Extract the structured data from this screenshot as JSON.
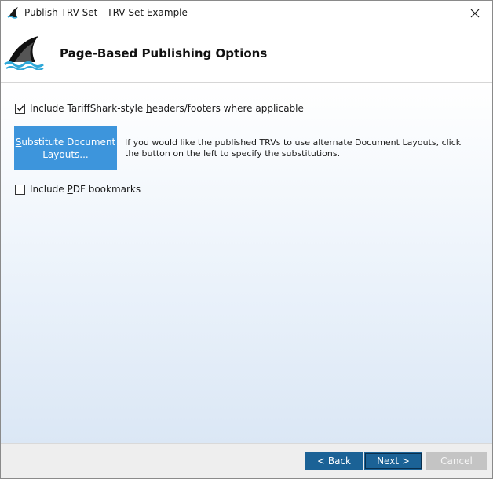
{
  "window": {
    "title": "Publish TRV Set - TRV Set Example",
    "icon": "tariffshark-fin-icon",
    "close_glyph": "✕"
  },
  "header": {
    "title": "Page-Based Publishing Options",
    "logo": "tariffshark-logo"
  },
  "options": {
    "headers_footers": {
      "label_pre": "Include TariffShark-style ",
      "label_underlined": "h",
      "label_post": "eaders/footers where applicable",
      "checked": true
    },
    "substitute_button": {
      "line1_underlined": "S",
      "line1_rest": "ubstitute Document",
      "line2": "Layouts..."
    },
    "substitute_help": "If you would like the published TRVs to use alternate Document Layouts, click the button on the left to specify the substitutions.",
    "pdf_bookmarks": {
      "label_pre": "Include ",
      "label_underlined": "P",
      "label_post": "DF bookmarks",
      "checked": false
    }
  },
  "footer": {
    "back_label": "< Back",
    "next_label": "Next >",
    "cancel_label": "Cancel"
  },
  "colors": {
    "accent": "#3d95dc",
    "nav_button": "#1b6296",
    "disabled_button": "#c4c4c4"
  }
}
